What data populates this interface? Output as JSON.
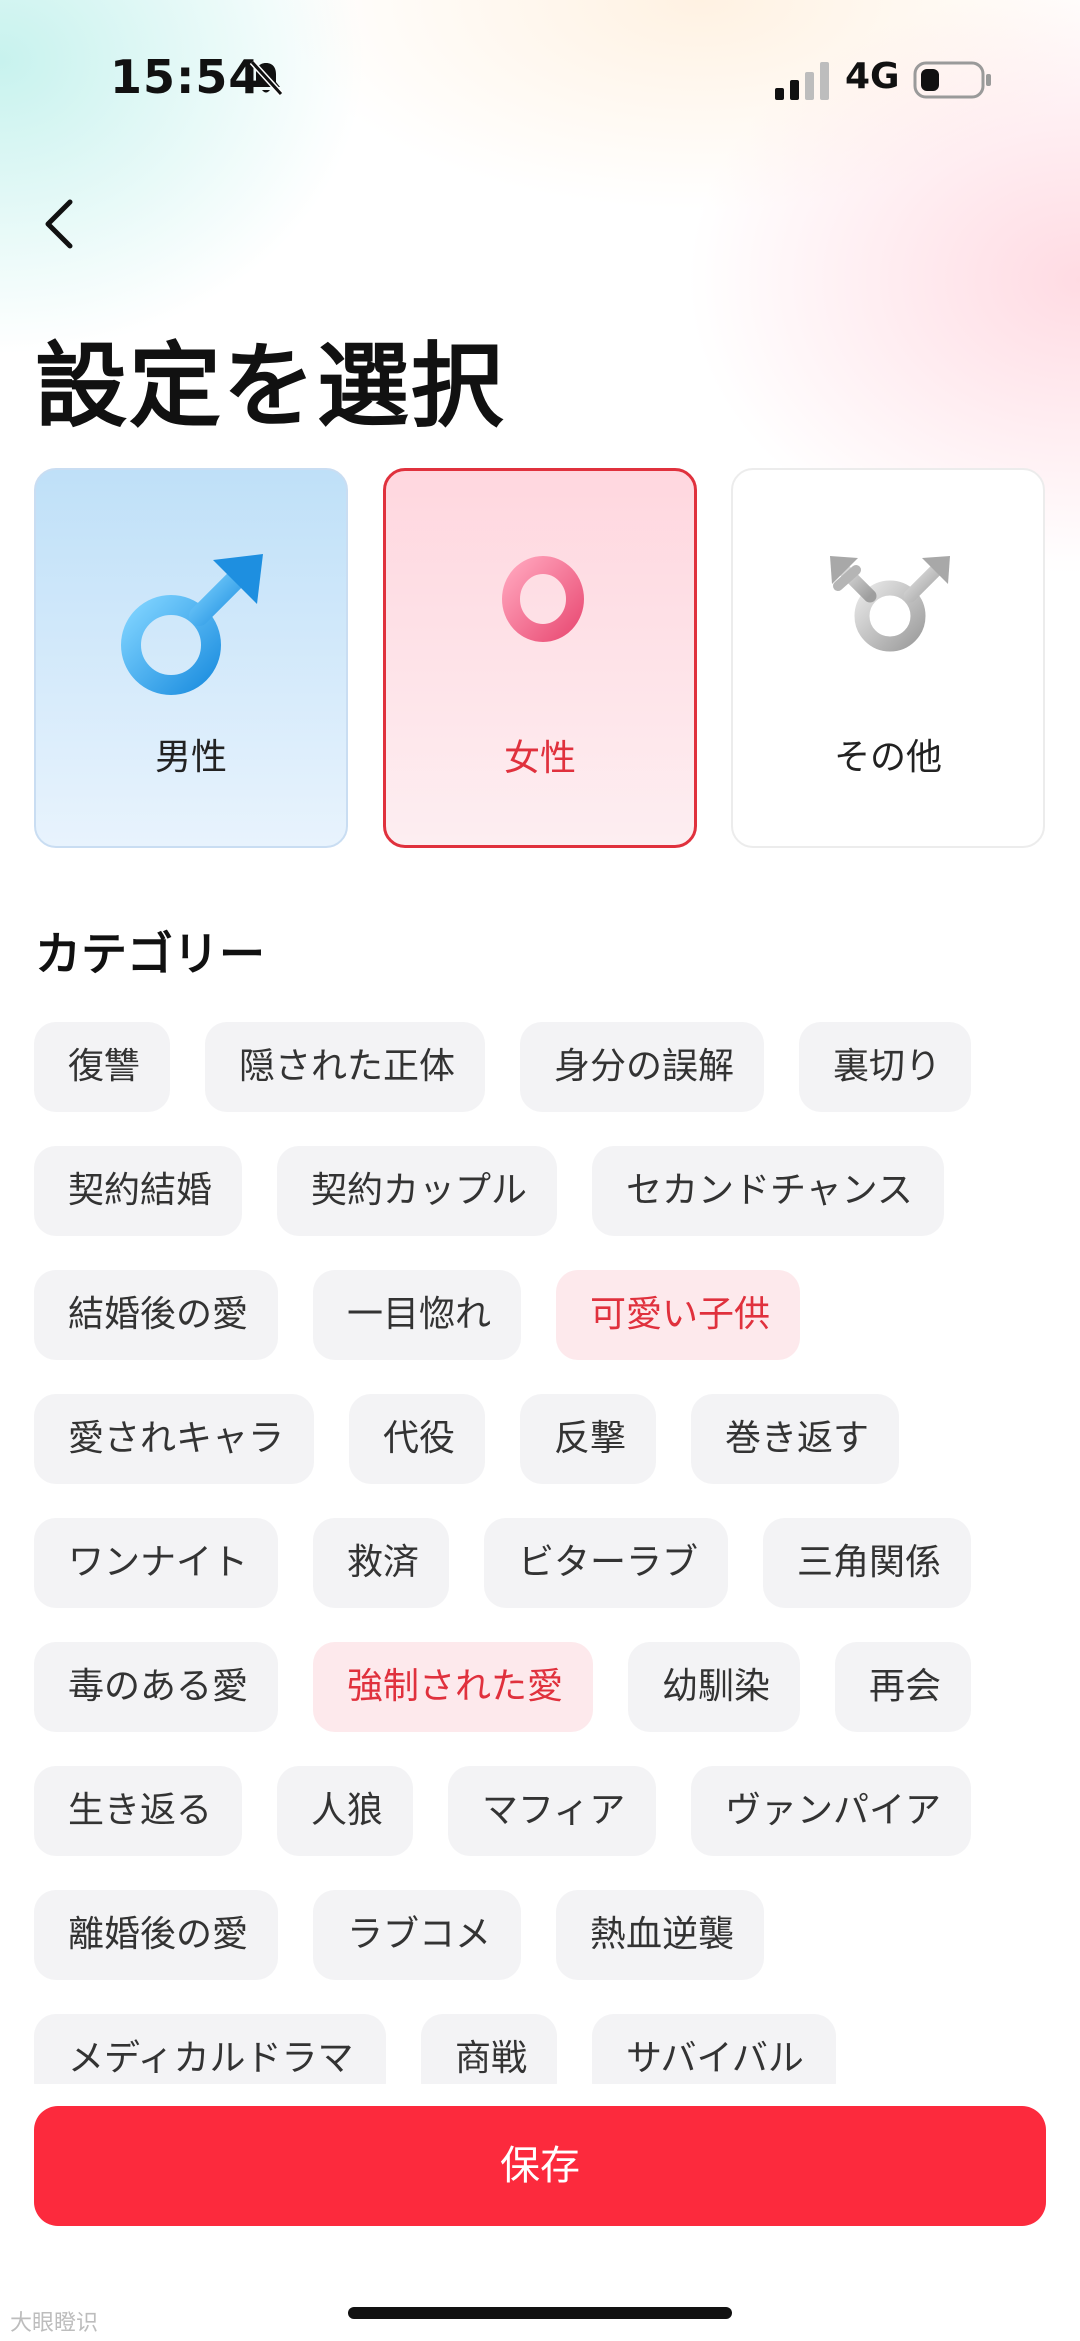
{
  "status_bar": {
    "time": "15:54",
    "network": "4G"
  },
  "header": {
    "title": "設定を選択"
  },
  "gender_options": [
    {
      "label": "男性",
      "selected": false
    },
    {
      "label": "女性",
      "selected": true
    },
    {
      "label": "その他",
      "selected": false
    }
  ],
  "categories": {
    "title": "カテゴリー",
    "tags": [
      {
        "label": "復讐",
        "selected": false
      },
      {
        "label": "隠された正体",
        "selected": false
      },
      {
        "label": "身分の誤解",
        "selected": false
      },
      {
        "label": "裏切り",
        "selected": false
      },
      {
        "label": "契約結婚",
        "selected": false
      },
      {
        "label": "契約カップル",
        "selected": false
      },
      {
        "label": "セカンドチャンス",
        "selected": false
      },
      {
        "label": "結婚後の愛",
        "selected": false
      },
      {
        "label": "一目惚れ",
        "selected": false
      },
      {
        "label": "可愛い子供",
        "selected": true
      },
      {
        "label": "愛されキャラ",
        "selected": false
      },
      {
        "label": "代役",
        "selected": false
      },
      {
        "label": "反撃",
        "selected": false
      },
      {
        "label": "巻き返す",
        "selected": false
      },
      {
        "label": "ワンナイト",
        "selected": false
      },
      {
        "label": "救済",
        "selected": false
      },
      {
        "label": "ビターラブ",
        "selected": false
      },
      {
        "label": "三角関係",
        "selected": false
      },
      {
        "label": "毒のある愛",
        "selected": false
      },
      {
        "label": "強制された愛",
        "selected": true
      },
      {
        "label": "幼馴染",
        "selected": false
      },
      {
        "label": "再会",
        "selected": false
      },
      {
        "label": "生き返る",
        "selected": false
      },
      {
        "label": "人狼",
        "selected": false
      },
      {
        "label": "マフィア",
        "selected": false
      },
      {
        "label": "ヴァンパイア",
        "selected": false
      },
      {
        "label": "離婚後の愛",
        "selected": false
      },
      {
        "label": "ラブコメ",
        "selected": false
      },
      {
        "label": "熱血逆襲",
        "selected": false
      },
      {
        "label": "メディカルドラマ",
        "selected": false
      },
      {
        "label": "商戦",
        "selected": false
      },
      {
        "label": "サバイバル",
        "selected": false
      }
    ]
  },
  "footer": {
    "save_label": "保存",
    "watermark": "大眼瞪识"
  },
  "colors": {
    "accent": "#fc2a3d",
    "selected_text": "#e0313d",
    "selected_bg": "#fde9ec",
    "tag_bg": "#f3f3f5"
  },
  "icons": {
    "back": "chevron-left-icon",
    "bell": "bell-slash-icon",
    "signal": "signal-icon",
    "battery": "battery-icon",
    "male": "male-symbol-icon",
    "female": "female-symbol-icon",
    "other": "transgender-symbol-icon"
  }
}
